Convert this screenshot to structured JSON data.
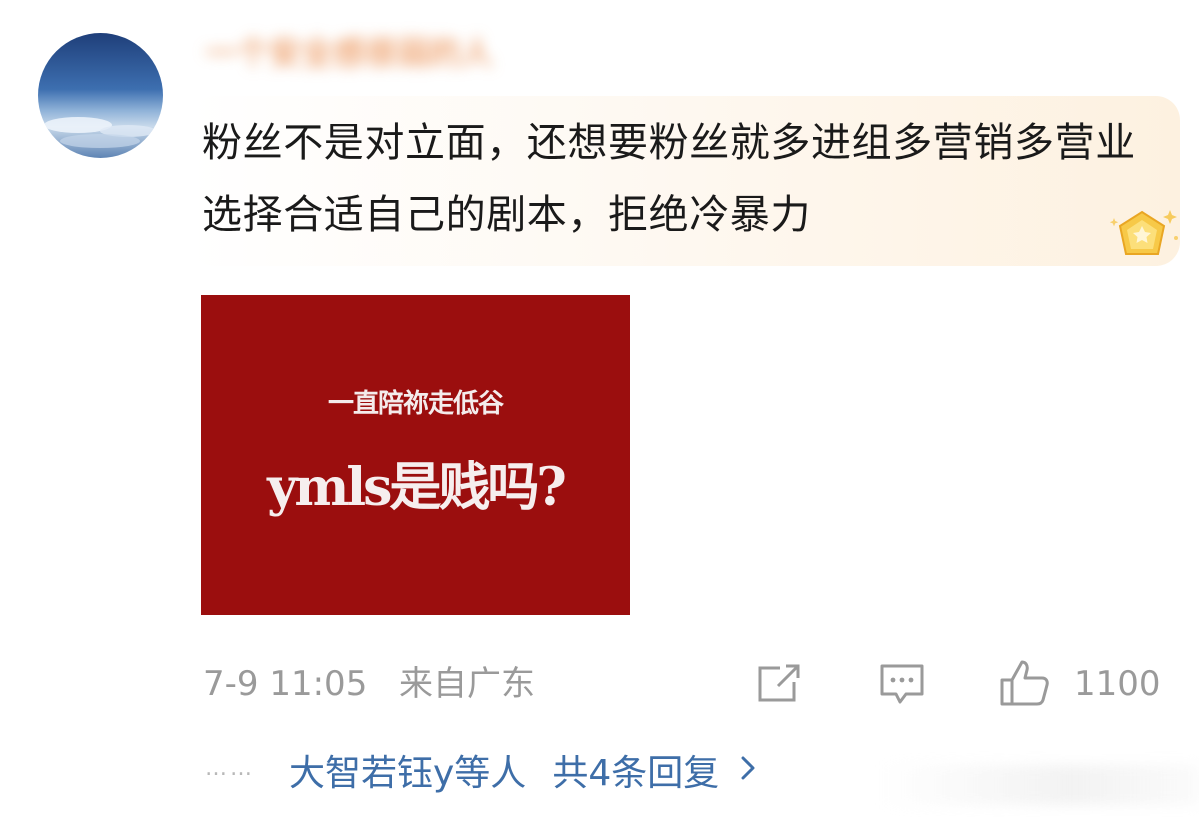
{
  "comment": {
    "username": "一个安全感很弱的人 ",
    "text": "粉丝不是对立面，还想要粉丝就多进组多营销多营业选择合适自己的剧本，拒绝冷暴力",
    "image": {
      "line1": "一直陪祢走低谷",
      "line2": "ymls是贱吗?",
      "background_color": "#9b0e0e"
    },
    "meta": {
      "timestamp": "7-9 11:05",
      "location": "来自广东"
    },
    "actions": {
      "share_icon": "share-icon",
      "comment_icon": "comment-icon",
      "like_icon": "thumbs-up-icon",
      "like_count": "1100"
    },
    "replies": {
      "dots": "……",
      "names": "大智若钰y等人",
      "total": "共4条回复",
      "chevron_icon": "chevron-right-icon"
    }
  },
  "colors": {
    "reply_link": "#3e6ea8",
    "meta_text": "#9a9a9a",
    "badge_gold": "#f5c23c"
  }
}
